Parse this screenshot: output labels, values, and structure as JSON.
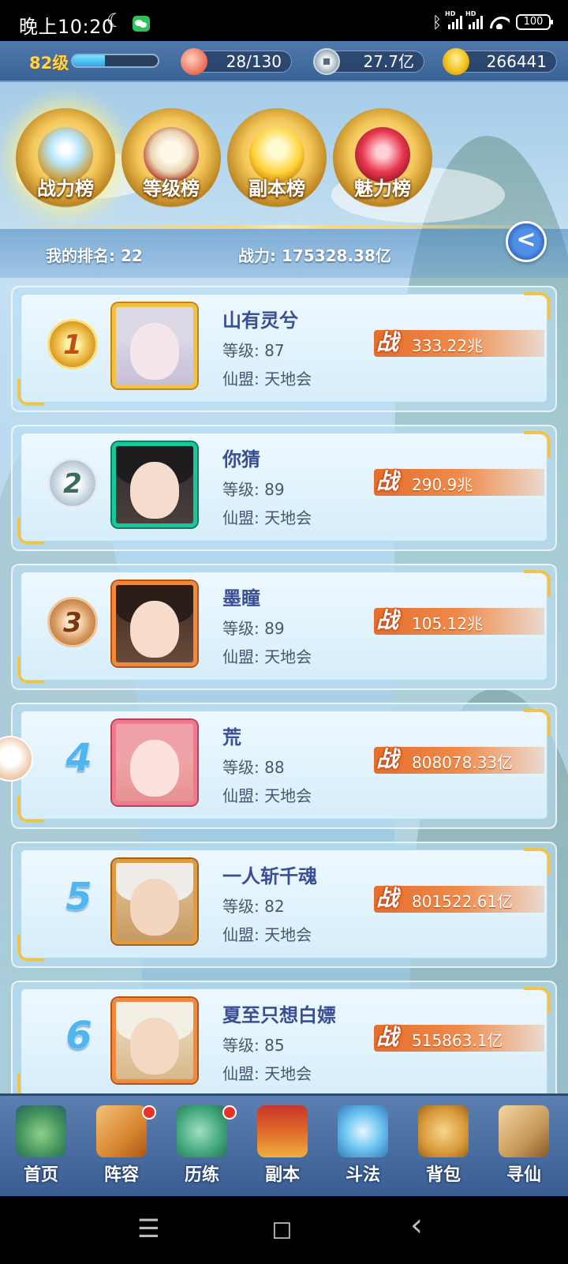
{
  "status_bar": {
    "time": "晚上10:20",
    "moon": "☾",
    "hd": "HD",
    "battery": "100"
  },
  "resources": {
    "level": "82级",
    "xp_progress": 0.38,
    "peach": "28/130",
    "copper": "27.7亿",
    "gold": "266441"
  },
  "tabs": [
    {
      "label": "战力榜",
      "active": true
    },
    {
      "label": "等级榜",
      "active": false
    },
    {
      "label": "副本榜",
      "active": false
    },
    {
      "label": "魅力榜",
      "active": false
    }
  ],
  "my_rank": {
    "rank_text": "我的排名: 22",
    "power_text": "战力: 175328.38亿"
  },
  "share_icon": "<",
  "power_badge": "战",
  "rows": [
    {
      "rank": "1",
      "name": "山有灵兮",
      "level": "等级: 87",
      "guild": "仙盟: 天地会",
      "power": "333.22兆"
    },
    {
      "rank": "2",
      "name": "你猜",
      "level": "等级: 89",
      "guild": "仙盟: 天地会",
      "power": "290.9兆"
    },
    {
      "rank": "3",
      "name": "墨瞳",
      "level": "等级: 89",
      "guild": "仙盟: 天地会",
      "power": "105.12兆"
    },
    {
      "rank": "4",
      "name": "荒",
      "level": "等级: 88",
      "guild": "仙盟: 天地会",
      "power": "808078.33亿"
    },
    {
      "rank": "5",
      "name": "一人斩千魂",
      "level": "等级: 82",
      "guild": "仙盟: 天地会",
      "power": "801522.61亿"
    },
    {
      "rank": "6",
      "name": "夏至只想白嫖",
      "level": "等级: 85",
      "guild": "仙盟: 天地会",
      "power": "515863.1亿"
    }
  ],
  "bottom_nav": [
    {
      "label": "首页",
      "dot": false
    },
    {
      "label": "阵容",
      "dot": true
    },
    {
      "label": "历练",
      "dot": true
    },
    {
      "label": "副本",
      "dot": false
    },
    {
      "label": "斗法",
      "dot": false
    },
    {
      "label": "背包",
      "dot": false
    },
    {
      "label": "寻仙",
      "dot": false
    }
  ],
  "system_nav": {
    "menu": "☰",
    "home": "◻",
    "back": "‹"
  },
  "colors": {
    "name": "#3a4e93",
    "power_bar": "#e36e2e",
    "level_gold": "#ffd34a",
    "nav_bg": "#3a5e93"
  }
}
